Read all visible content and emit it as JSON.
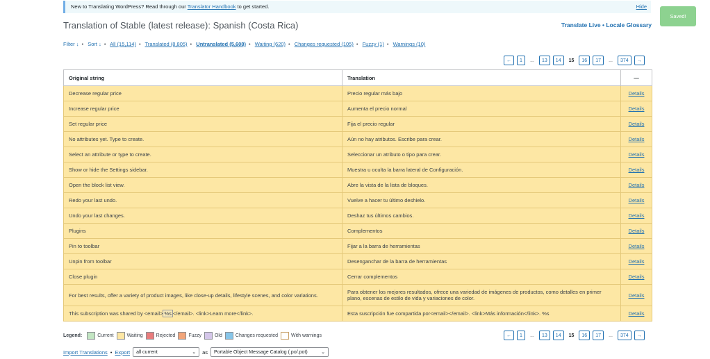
{
  "notice": {
    "text_before": "New to Translating WordPress? Read through our ",
    "link": "Translator Handbook",
    "text_after": " to get started.",
    "hide": "Hide"
  },
  "title": "Translation of Stable (latest release): Spanish (Costa Rica)",
  "top_links": {
    "live": "Translate Live",
    "sep": "•",
    "glossary": "Locale Glossary"
  },
  "saved": "Saved!",
  "filters": {
    "filter": "Filter ↓",
    "sort": "Sort ↓",
    "all": "All (15,114)",
    "translated": "Translated (8,805)",
    "untranslated": "Untranslated (5,608)",
    "waiting": "Waiting (620)",
    "changes": "Changes requested (105)",
    "fuzzy": "Fuzzy (1)",
    "warnings": "Warnings (10)"
  },
  "pager": {
    "prev": "←",
    "p1": "1",
    "dots1": "...",
    "p13": "13",
    "p14": "14",
    "p15": "15",
    "p16": "16",
    "p17": "17",
    "dots2": "...",
    "last": "374",
    "next": "→"
  },
  "table": {
    "headers": {
      "original": "Original string",
      "translation": "Translation",
      "actions": "—"
    },
    "details": "Details",
    "rows": [
      {
        "original": "Decrease regular price",
        "translation": "Precio regular más bajo"
      },
      {
        "original": "Increase regular price",
        "translation": "Aumenta el precio normal"
      },
      {
        "original": "Set regular price",
        "translation": "Fija el precio regular"
      },
      {
        "original": "No attributes yet. Type to create.",
        "translation": "Aún no hay atributos. Escribe para crear."
      },
      {
        "original": "Select an attribute or type to create.",
        "translation": "Seleccionar un atributo o tipo para crear."
      },
      {
        "original": "Show or hide the Settings sidebar.",
        "translation": "Muestra u oculta la barra lateral de Configuración."
      },
      {
        "original": "Open the block list view.",
        "translation": "Abre la vista de la lista de bloques."
      },
      {
        "original": "Redo your last undo.",
        "translation": "Vuelve a hacer tu último deshielo."
      },
      {
        "original": "Undo your last changes.",
        "translation": "Deshaz tus últimos cambios."
      },
      {
        "original": "Plugins",
        "translation": "Complementos"
      },
      {
        "original": "Pin to toolbar",
        "translation": "Fijar a la barra de herramientas"
      },
      {
        "original": "Unpin from toolbar",
        "translation": "Desenganchar de la barra de herramientas"
      },
      {
        "original": "Close plugin",
        "translation": "Cerrar complementos"
      },
      {
        "original": "For best results, offer a variety of product images, like close-up details, lifestyle scenes, and color variations.",
        "translation": "Para obtener los mejores resultados, ofrece una variedad de imágenes de productos, como detalles en primer plano, escenas de estilo de vida y variaciones de color."
      }
    ],
    "last_row": {
      "original_before": "This subscription was shared by <email>",
      "placeholder": "%s",
      "original_after": "</email>. <link>Learn more</link>.",
      "translation": "Esta suscripción fue compartida por<email></email>. <link>Más información</link>. %s"
    }
  },
  "legend": {
    "label": "Legend:",
    "items": [
      {
        "label": "Current",
        "color": "#c3e6c3"
      },
      {
        "label": "Waiting",
        "color": "#fde7a4"
      },
      {
        "label": "Rejected",
        "color": "#e97c7c"
      },
      {
        "label": "Fuzzy",
        "color": "#f2a57a"
      },
      {
        "label": "Old",
        "color": "#d4c6e9"
      },
      {
        "label": "Changes requested",
        "color": "#87c5e8"
      },
      {
        "label": "With warnings",
        "color": "#ffffff"
      }
    ]
  },
  "bottom": {
    "import": "Import Translations",
    "sep": "•",
    "export": "Export",
    "scope": "all current",
    "as": "as",
    "format": "Portable Object Message Catalog (.po/.pot)"
  }
}
